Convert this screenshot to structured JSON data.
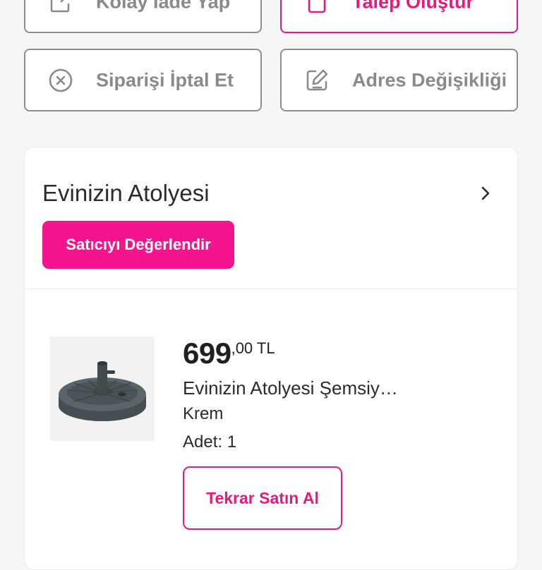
{
  "actions": {
    "easy_return": {
      "label": "Kolay İade Yap",
      "icon": "external-edit-icon"
    },
    "create_request": {
      "label": "Talep Oluştur",
      "icon": "clipboard-icon"
    },
    "cancel_order": {
      "label": "Siparişi İptal Et",
      "icon": "circle-x-icon"
    },
    "address_change": {
      "label": "Adres Değişikliği",
      "icon": "pencil-square-icon"
    }
  },
  "seller": {
    "name": "Evinizin Atolyesi",
    "rate_button": "Satıcıyı Değerlendir"
  },
  "product": {
    "price_int": "699",
    "price_dec": ",00 TL",
    "title": "Evinizin Atolyesi Şemsiy…",
    "variant": "Krem",
    "quantity": "Adet: 1",
    "rebuy_button": "Tekrar Satın Al",
    "image": "umbrella-base-image"
  },
  "colors": {
    "accent": "#f5148d",
    "accent_border": "#e8187d",
    "muted_text": "#8a8a8a",
    "border_gray": "#8d8d8d",
    "background": "#f6f6f6"
  }
}
